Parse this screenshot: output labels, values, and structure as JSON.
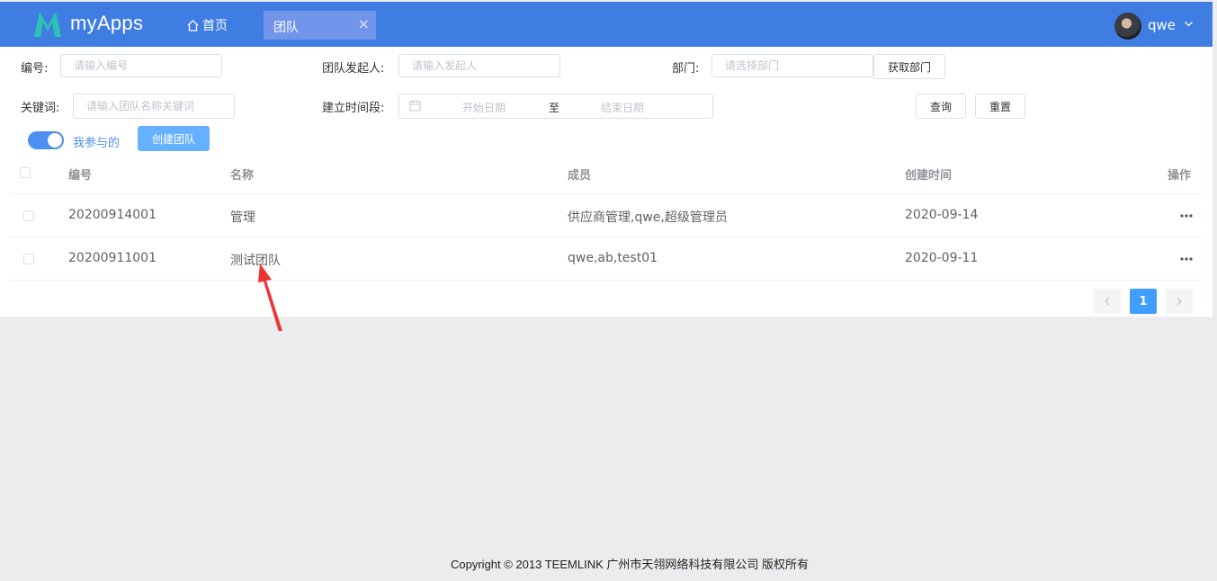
{
  "colors": {
    "topbar": "#3f7de3",
    "accent": "#409eff",
    "active_tab": "#7294eb",
    "annotation_arrow": "#ee3333"
  },
  "header": {
    "logo_text": "myApps",
    "home_label": "首页",
    "active_tab_label": "团队",
    "user_name": "qwe"
  },
  "filters": {
    "number_label": "编号:",
    "number_placeholder": "请输入编号",
    "initiator_label": "团队发起人:",
    "initiator_placeholder": "请输入发起人",
    "department_label": "部门:",
    "department_placeholder": "请选择部门",
    "get_department_button": "获取部门",
    "keyword_label": "关键词:",
    "keyword_placeholder": "请输入团队名称关键词",
    "period_label": "建立时间段:",
    "start_date_placeholder": "开始日期",
    "range_separator": "至",
    "end_date_placeholder": "结束日期",
    "query_button": "查询",
    "reset_button": "重置",
    "toggle_label": "我参与的",
    "toggle_on": true,
    "create_button": "创建团队"
  },
  "table": {
    "headers": {
      "number": "编号",
      "name": "名称",
      "members": "成员",
      "created": "创建时间",
      "actions": "操作"
    },
    "rows": [
      {
        "number": "20200914001",
        "name": "管理",
        "members": "供应商管理,qwe,超级管理员",
        "created": "2020-09-14"
      },
      {
        "number": "20200911001",
        "name": "测试团队",
        "members": "qwe,ab,test01",
        "created": "2020-09-11"
      }
    ]
  },
  "pagination": {
    "current_page": "1"
  },
  "icons": [
    "logo-m-icon",
    "home-icon",
    "close-icon",
    "avatar",
    "chevron-down-icon",
    "calendar-icon",
    "more-icon",
    "chevron-left-icon",
    "chevron-right-icon",
    "annotation-arrow"
  ],
  "footer": {
    "copyright": "Copyright © 2013 TEEMLINK 广州市天翎网络科技有限公司 版权所有"
  }
}
